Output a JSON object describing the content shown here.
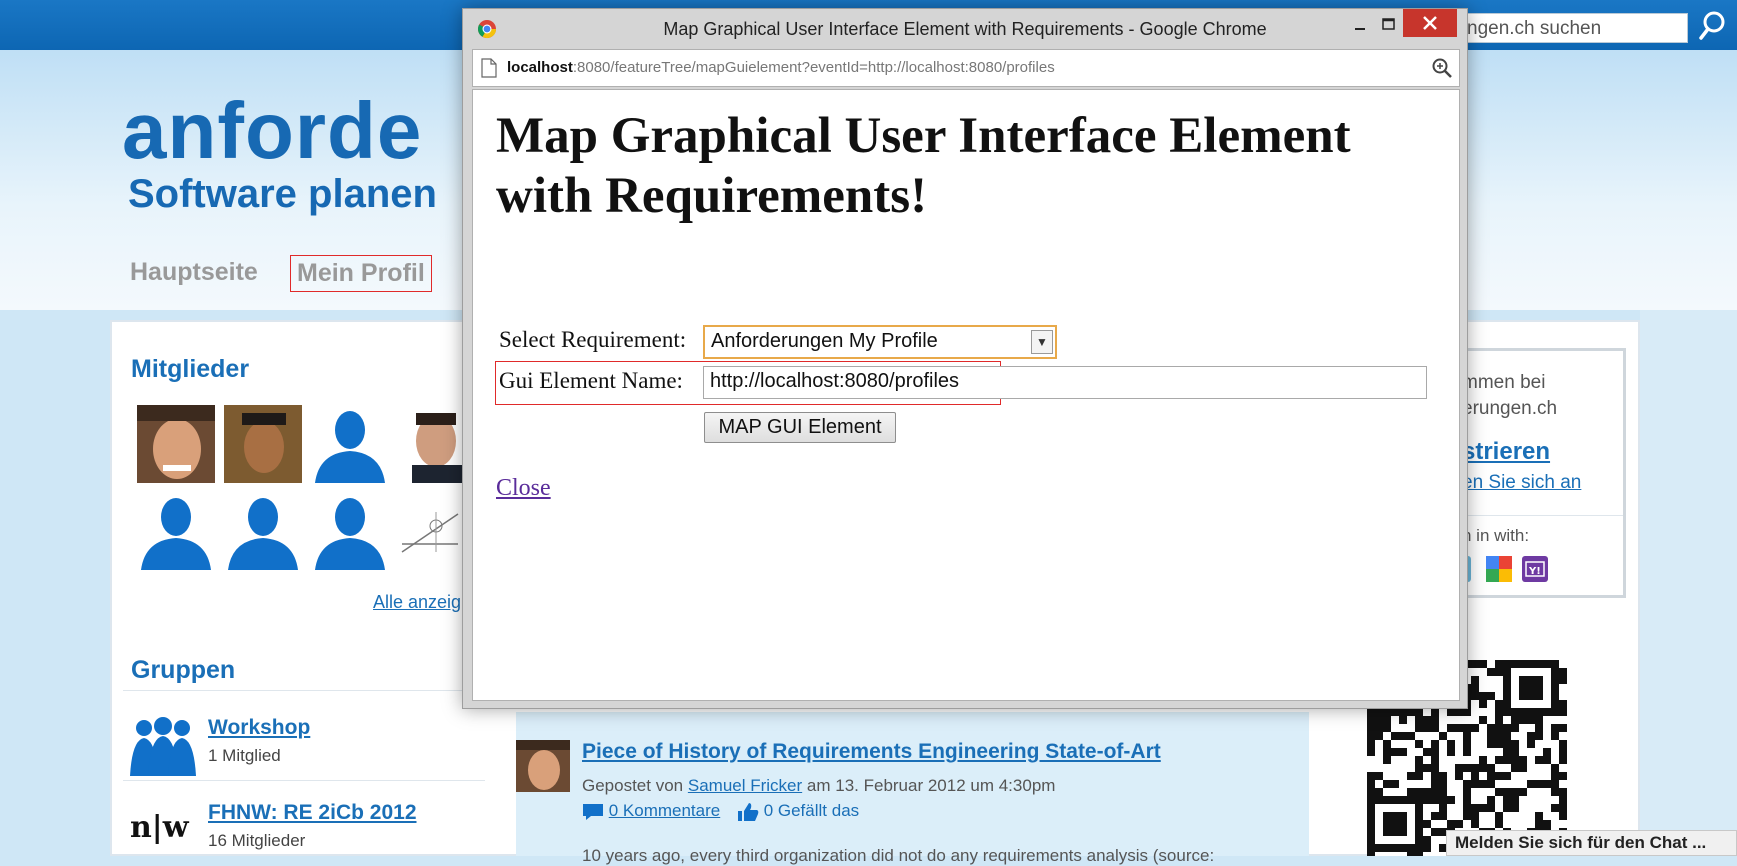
{
  "site": {
    "search_placeholder": "ngen.ch suchen",
    "logo": "anforde",
    "tagline": "Software planen",
    "nav": [
      "Hauptseite",
      "Mein Profil"
    ],
    "members_title": "Mitglieder",
    "show_all": "Alle anzeig",
    "groups_title": "Gruppen",
    "groups": [
      {
        "name": "Workshop",
        "count": "1 Mitglied"
      },
      {
        "name": "FHNW: RE 2iCb 2012",
        "count": "16 Mitglieder",
        "logo": "n|w"
      }
    ],
    "blog_post": {
      "title": "Piece of History of Requirements Engineering State-of-Art",
      "meta_prefix": "Gepostet von",
      "author": "Samuel Fricker",
      "meta_suffix": "am 13. Februar 2012 um 4:30pm",
      "comments": "0 Kommentare",
      "likes": "0 Gefällt das",
      "excerpt": "10 years ago, every third organization did not do any requirements analysis (source:"
    },
    "login": {
      "line1": "mmen bei",
      "line2": "erungen.ch",
      "register": "strieren",
      "signin": "en Sie sich an",
      "with": "n in with:"
    },
    "chat_bar": "Melden Sie sich für den Chat ..."
  },
  "popup": {
    "window_title": "Map Graphical User Interface Element with Requirements - Google Chrome",
    "url_host": "localhost",
    "url_rest": ":8080/featureTree/mapGuielement?eventId=http://localhost:8080/profiles",
    "heading": "Map Graphical User Interface Element with Requirements!",
    "select_label": "Select Requirement:",
    "select_value": "Anforderungen My Profile",
    "name_label": "Gui Element Name:",
    "name_value": "http://localhost:8080/profiles",
    "map_button": "MAP GUI Element",
    "close_link": "Close"
  },
  "colors": {
    "brand_blue": "#1769b3",
    "highlight_red": "#e02a2a",
    "close_button_red": "#c7352c"
  }
}
